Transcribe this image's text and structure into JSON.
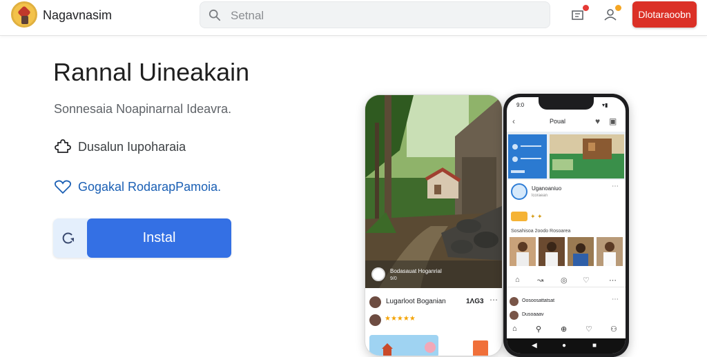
{
  "header": {
    "app_name": "Nagavnasim",
    "search_placeholder": "Setnal",
    "action_button": "Dlotaraoobn"
  },
  "hero": {
    "title": "Rannal Uineakain",
    "subtitle": "Sonnesaia Noapinarnal Ideavra.",
    "features": [
      {
        "icon": "puzzle-icon",
        "label": "Dusalun Iupoharaia"
      },
      {
        "icon": "heart-icon",
        "label": "Gogakal RodarapPamoia."
      }
    ],
    "install_label": "Instal"
  },
  "phone_left": {
    "caption_title": "Bodasauat Hoganrial",
    "caption_sub": "9/0",
    "post_name": "Lugarloot Boganian",
    "post_count": "1ΛG3",
    "rating": "★★★★★"
  },
  "phone_right": {
    "time": "9:0",
    "screen_title": "Poual",
    "profile_name": "Uganoaniuo",
    "profile_sub": "lcoraean",
    "section_label": "Sosahisoa 2oodo Rosoarea",
    "comments": [
      {
        "text": "Oosoosattatsat"
      },
      {
        "text": "Dusoaaav"
      }
    ]
  },
  "colors": {
    "accent_blue": "#3470e4",
    "header_button": "#db3026",
    "feature_link": "#1a5fb4"
  }
}
